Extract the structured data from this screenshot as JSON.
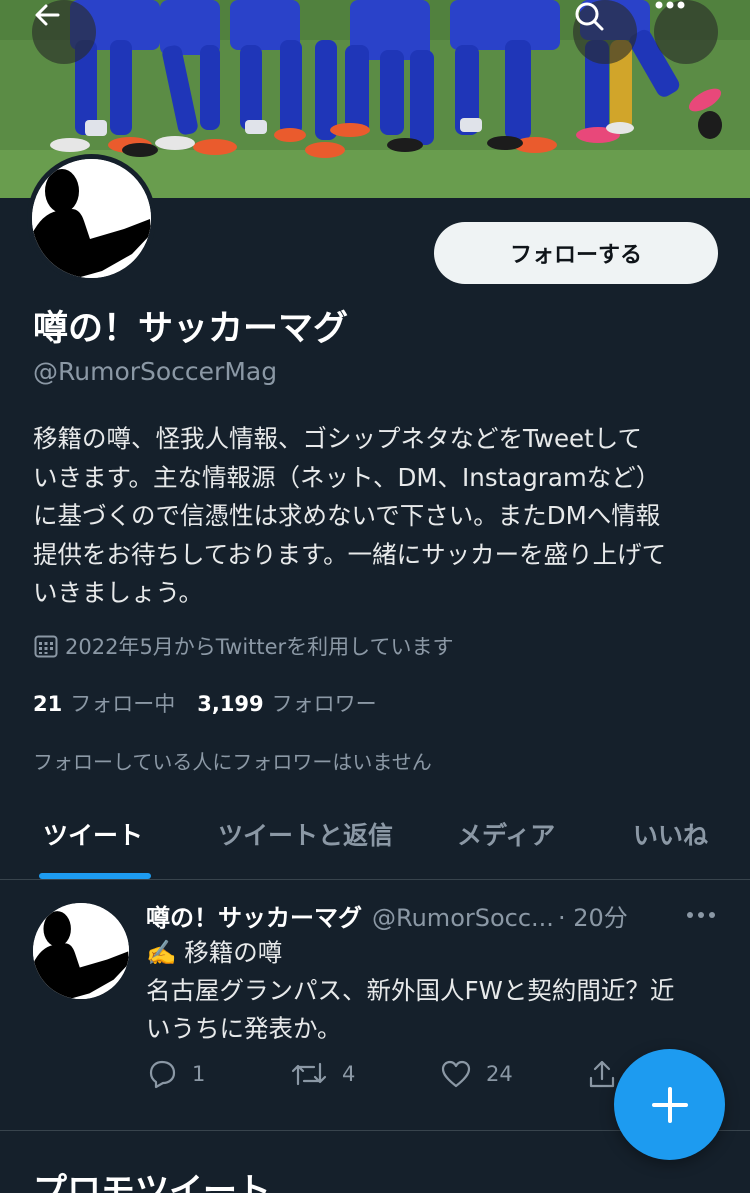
{
  "profile": {
    "display_name": "噂の！サッカーマグ",
    "handle": "@RumorSoccerMag",
    "follow_button": "フォローする",
    "bio": [
      "移籍の噂、怪我人情報、ゴシップネタなどをTweetして",
      "いきます。主な情報源（ネット、DM、Instagramなど）",
      "に基づくので信憑性は求めないで下さい。またDMへ情報",
      "提供をお待ちしております。一緒にサッカーを盛り上げて",
      "いきましょう。"
    ],
    "joined": "2022年5月からTwitterを利用しています",
    "following_count": "21",
    "following_label": "フォロー中",
    "followers_count": "3,199",
    "followers_label": "フォロワー",
    "no_mutual_followers": "フォローしている人にフォロワーはいません"
  },
  "tabs": [
    {
      "label": "ツイート",
      "active": true
    },
    {
      "label": "ツイートと返信",
      "active": false
    },
    {
      "label": "メディア",
      "active": false
    },
    {
      "label": "いいね",
      "active": false
    }
  ],
  "tweet": {
    "name": "噂の！サッカーマグ",
    "handle": "@RumorSocc...",
    "time": "· 20分",
    "lines": [
      "✍️ 移籍の噂",
      "名古屋グランパス、新外国人FWと契約間近？近",
      "いうちに発表か。"
    ],
    "replies": "1",
    "retweets": "4",
    "likes": "24"
  },
  "next_section_title": "プロモツイート",
  "icons": {
    "back": "back-arrow-icon",
    "search": "search-icon",
    "more": "more-icon",
    "calendar": "calendar-icon",
    "reply": "reply-icon",
    "retweet": "retweet-icon",
    "like": "like-icon",
    "share": "share-icon",
    "compose": "compose-plus-icon"
  },
  "colors": {
    "background": "#15202b",
    "accent": "#1d9bf0",
    "secondary_text": "#8b98a5"
  }
}
